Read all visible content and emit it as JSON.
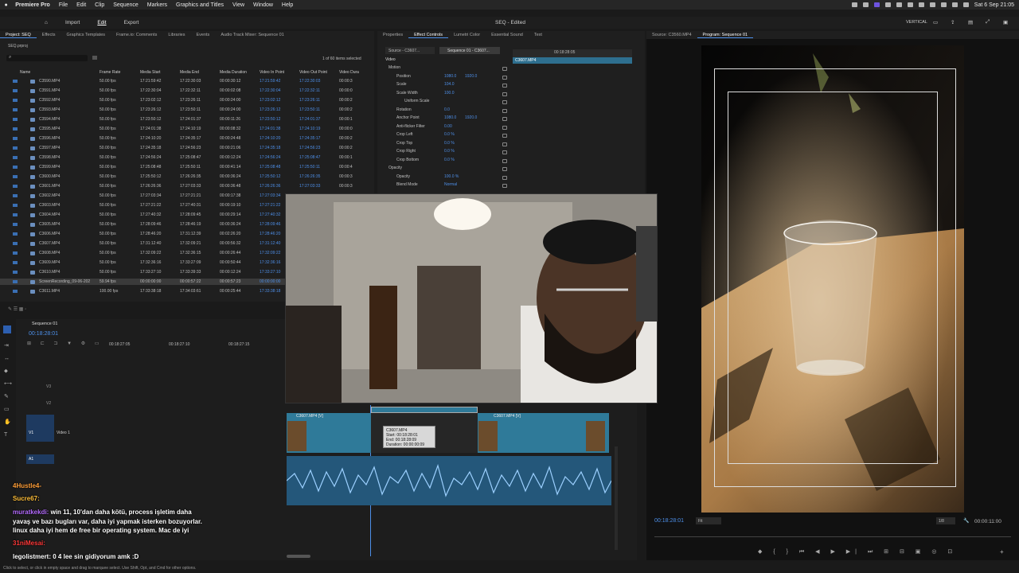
{
  "menubar": {
    "app": "Premiere Pro",
    "items": [
      "File",
      "Edit",
      "Clip",
      "Sequence",
      "Markers",
      "Graphics and Titles",
      "View",
      "Window",
      "Help"
    ],
    "datetime": "Sat 6 Sep  21:05"
  },
  "header": {
    "import": "Import",
    "edit": "Edit",
    "export": "Export",
    "title": "SEQ - Edited",
    "workspace": "VERTICAL"
  },
  "project": {
    "tabs": [
      "Project: SEQ",
      "Effects",
      "Graphics Templates",
      "Frame.io: Comments",
      "Libraries",
      "Events",
      "Audio Track Mixer: Sequence 01"
    ],
    "file": "SEQ.prproj",
    "selection": "1 of 60 items selected",
    "columns": [
      "Name",
      "Frame Rate",
      "Media Start",
      "Media End",
      "Media Duration",
      "Video In Point",
      "Video Out Point",
      "Video Dura"
    ],
    "rows": [
      [
        "C3590.MP4",
        "50.00 fps",
        "17:21:59:42",
        "17:22:30:03",
        "00:00:30:12",
        "17:21:59:42",
        "17:22:30:03",
        "00:00:3"
      ],
      [
        "C3591.MP4",
        "50.00 fps",
        "17:22:30:04",
        "17:22:32:11",
        "00:00:02:08",
        "17:22:30:04",
        "17:22:32:11",
        "00:00:0"
      ],
      [
        "C3592.MP4",
        "50.00 fps",
        "17:23:02:12",
        "17:23:26:11",
        "00:00:24:00",
        "17:23:02:12",
        "17:23:26:11",
        "00:00:2"
      ],
      [
        "C3593.MP4",
        "50.00 fps",
        "17:23:26:12",
        "17:23:50:11",
        "00:00:24:00",
        "17:23:26:12",
        "17:23:50:11",
        "00:00:2"
      ],
      [
        "C3594.MP4",
        "50.00 fps",
        "17:23:50:12",
        "17:24:01:37",
        "00:00:11:26",
        "17:23:50:12",
        "17:24:01:37",
        "00:00:1"
      ],
      [
        "C3595.MP4",
        "50.00 fps",
        "17:24:01:38",
        "17:24:10:19",
        "00:00:08:32",
        "17:24:01:38",
        "17:24:10:19",
        "00:00:0"
      ],
      [
        "C3596.MP4",
        "50.00 fps",
        "17:24:10:20",
        "17:24:35:17",
        "00:00:24:48",
        "17:24:10:20",
        "17:24:35:17",
        "00:00:2"
      ],
      [
        "C3597.MP4",
        "50.00 fps",
        "17:24:35:18",
        "17:24:56:23",
        "00:00:21:06",
        "17:24:35:18",
        "17:24:56:23",
        "00:00:2"
      ],
      [
        "C3598.MP4",
        "50.00 fps",
        "17:24:56:24",
        "17:25:08:47",
        "00:00:12:24",
        "17:24:56:24",
        "17:25:08:47",
        "00:00:1"
      ],
      [
        "C3599.MP4",
        "50.00 fps",
        "17:25:08:48",
        "17:25:50:11",
        "00:00:41:14",
        "17:25:08:48",
        "17:25:50:11",
        "00:00:4"
      ],
      [
        "C3600.MP4",
        "50.00 fps",
        "17:25:50:12",
        "17:26:26:35",
        "00:00:36:24",
        "17:25:50:12",
        "17:26:26:35",
        "00:00:3"
      ],
      [
        "C3601.MP4",
        "50.00 fps",
        "17:26:26:36",
        "17:27:03:33",
        "00:00:36:48",
        "17:26:26:36",
        "17:27:03:33",
        "00:00:3"
      ],
      [
        "C3602.MP4",
        "50.00 fps",
        "17:27:03:34",
        "17:27:21:21",
        "00:00:17:38",
        "17:27:03:34",
        "17:27:21:21",
        "00:00:1"
      ],
      [
        "C3603.MP4",
        "50.00 fps",
        "17:27:21:22",
        "17:27:40:31",
        "00:00:19:10",
        "17:27:21:22",
        "17:27:40:31",
        "00:00:1"
      ],
      [
        "C3604.MP4",
        "50.00 fps",
        "17:27:40:32",
        "17:28:09:45",
        "00:00:29:14",
        "17:27:40:32",
        "17:28:09:45",
        "00:00:2"
      ],
      [
        "C3605.MP4",
        "50.00 fps",
        "17:28:09:46",
        "17:28:46:19",
        "00:00:36:24",
        "17:28:09:46",
        "17:28:46:19",
        "00:00:3"
      ],
      [
        "C3606.MP4",
        "50.00 fps",
        "17:28:46:20",
        "17:31:12:39",
        "00:02:26:20",
        "17:28:46:20",
        "17:31:12:39",
        "00:02:2"
      ],
      [
        "C3607.MP4",
        "50.00 fps",
        "17:31:12:40",
        "17:32:09:21",
        "00:00:56:32",
        "17:31:12:40",
        "17:32:09:21",
        "00:00:5"
      ],
      [
        "C3608.MP4",
        "50.00 fps",
        "17:32:09:22",
        "17:32:36:15",
        "00:00:26:44",
        "17:32:09:22",
        "17:32:36:15",
        "00:00:2"
      ],
      [
        "C3609.MP4",
        "50.00 fps",
        "17:32:36:16",
        "17:33:27:09",
        "00:00:50:44",
        "17:32:36:16",
        "17:33:27:09",
        "00:00:5"
      ],
      [
        "C3610.MP4",
        "50.00 fps",
        "17:33:27:10",
        "17:33:39:33",
        "00:00:12:24",
        "17:33:27:10",
        "17:33:39:33",
        "00:00:1"
      ],
      [
        "ScreenRecording_09-06-202",
        "59.94 fps",
        "00:00:00:00",
        "00:00:57:22",
        "00:00:57:23",
        "00:00:00:00",
        "00:00:57:22",
        "00:00:5"
      ],
      [
        "C3611.MP4",
        "100.00 fps",
        "17:33:38:18",
        "17:34:03:61",
        "00:00:25:44",
        "17:33:38:18",
        "17:34:03:61",
        "00:00:2"
      ]
    ]
  },
  "effects": {
    "tabs": [
      "Properties",
      "Effect Controls",
      "Lumetri Color",
      "Essential Sound",
      "Text"
    ],
    "source": "Source - C3607...",
    "sequence": "Sequence 01 - C3607...",
    "timecode": "00:18:28:05",
    "clip": "C3607.MP4",
    "section": "Video",
    "rows": [
      {
        "label": "Motion",
        "value": "",
        "value2": "",
        "indent": 0
      },
      {
        "label": "Position",
        "value": "1080.0",
        "value2": "1920.0",
        "indent": 2
      },
      {
        "label": "Scale",
        "value": "104.0",
        "value2": "",
        "indent": 2
      },
      {
        "label": "Scale Width",
        "value": "100.0",
        "value2": "",
        "indent": 2
      },
      {
        "label": "Uniform Scale",
        "value": "",
        "value2": "",
        "indent": 4
      },
      {
        "label": "Rotation",
        "value": "0.0",
        "value2": "",
        "indent": 2
      },
      {
        "label": "Anchor Point",
        "value": "1080.0",
        "value2": "1920.0",
        "indent": 2
      },
      {
        "label": "Anti-flicker Filter",
        "value": "0.00",
        "value2": "",
        "indent": 2
      },
      {
        "label": "Crop Left",
        "value": "0.0 %",
        "value2": "",
        "indent": 2
      },
      {
        "label": "Crop Top",
        "value": "0.0 %",
        "value2": "",
        "indent": 2
      },
      {
        "label": "Crop Right",
        "value": "0.0 %",
        "value2": "",
        "indent": 2
      },
      {
        "label": "Crop Bottom",
        "value": "0.0 %",
        "value2": "",
        "indent": 2
      },
      {
        "label": "Opacity",
        "value": "",
        "value2": "",
        "indent": 0
      },
      {
        "label": "Opacity",
        "value": "100.0 %",
        "value2": "",
        "indent": 2
      },
      {
        "label": "Blend Mode",
        "value": "Normal",
        "value2": "",
        "indent": 2
      }
    ]
  },
  "program": {
    "tabs": [
      "Source: C3560.MP4",
      "Program: Sequence 01"
    ],
    "timecode": "00:18:28:01",
    "fit": "Fit",
    "resolution": "1/8",
    "duration": "00:00:11:00"
  },
  "timeline": {
    "sequence": "Sequence 01",
    "timecode": "00:18:28:01",
    "ruler": [
      "00:18:27:05",
      "00:18:27:10",
      "00:18:27:15"
    ],
    "tracks": [
      "V3",
      "V2",
      "V1",
      "A1"
    ],
    "video_track_name": "Video 1",
    "clip_label": "C3607.MP4 [V]",
    "clip_label_2": "C3607.MP4 [V]",
    "tooltip": {
      "name": "C3607.MP4",
      "start": "Start: 00:18:28:01",
      "end": "End: 00:18:28:09",
      "duration": "Duration: 00:00:00:09"
    }
  },
  "chat": [
    {
      "user": "4Hustle4-",
      "text": ""
    },
    {
      "user": "Sucre67:",
      "text": ""
    },
    {
      "user": "muratkekdi:",
      "text": "win 11, 10'dan daha kötü, process işletim daha"
    },
    {
      "user": "",
      "text": "yavaş ve bazı bugları var, daha iyi yapmak isterken bozuyorlar."
    },
    {
      "user": "",
      "text": "linux daha iyi hem de free bir operating system. Mac de iyi"
    },
    {
      "user": "31niMesai:",
      "text": ""
    },
    {
      "user": "legolistmert:",
      "text": "0 4 lee sin gidiyorum amk :D"
    }
  ],
  "status": "Click to select, or click in empty space and drag to marquee select. Use Shift, Opt, and Cmd for other options.",
  "colors": {
    "accent": "#4d8fe8",
    "clip": "#2f7a99",
    "audio": "#3b86b8"
  }
}
